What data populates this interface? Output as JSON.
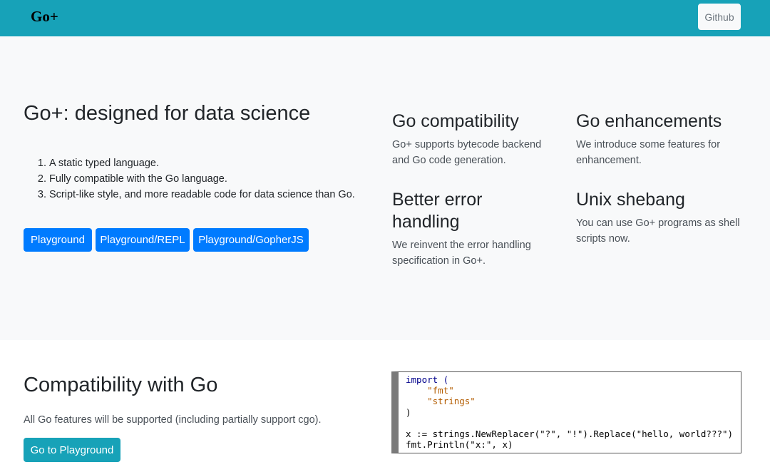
{
  "navbar": {
    "brand": "Go+",
    "github_label": "Github"
  },
  "hero": {
    "title": "Go+: designed for data science",
    "list": [
      "A static typed language.",
      "Fully compatible with the Go language.",
      "Script-like style, and more readable code for data science than Go."
    ],
    "buttons": [
      "Playground",
      "Playground/REPL",
      "Playground/GopherJS"
    ]
  },
  "features": [
    {
      "title": "Go compatibility",
      "text": "Go+ supports bytecode backend and Go code generation."
    },
    {
      "title": "Go enhancements",
      "text": "We introduce some features for enhancement."
    },
    {
      "title": "Better error handling",
      "text": "We reinvent the error handling specification in Go+."
    },
    {
      "title": "Unix shebang",
      "text": "You can use Go+ programs as shell scripts now."
    }
  ],
  "compat": {
    "title": "Compatibility with Go",
    "text": "All Go features will be supported (including partially support cgo).",
    "button": "Go to Playground"
  },
  "code": {
    "lines": [
      "import (",
      "    \"fmt\"",
      "    \"strings\"",
      ")",
      "",
      "x := strings.NewReplacer(\"?\", \"!\").Replace(\"hello, world???\")",
      "fmt.Println(\"x:\", x)"
    ]
  },
  "colors": {
    "navbar": "#17a2b8",
    "primary": "#007bff",
    "info": "#17a2b8",
    "hero_bg": "#f8f9fa"
  }
}
